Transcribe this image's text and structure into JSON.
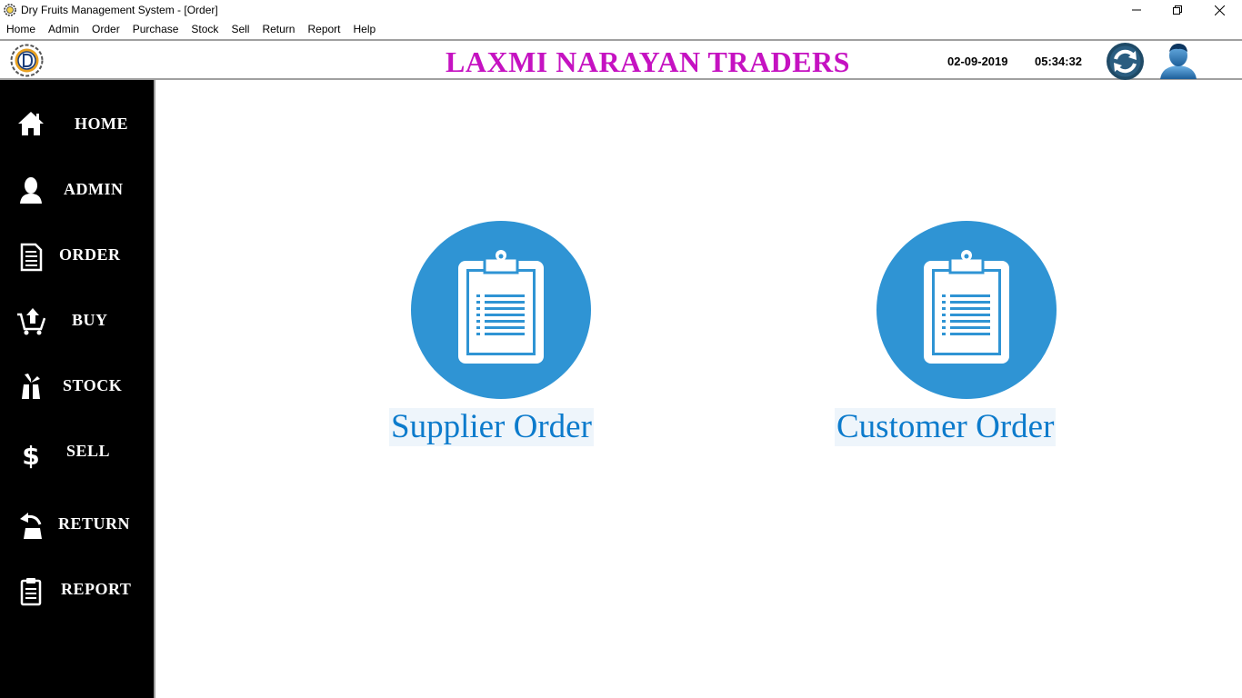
{
  "window": {
    "title": "Dry Fruits Management System - [Order]"
  },
  "menu": [
    "Home",
    "Admin",
    "Order",
    "Purchase",
    "Stock",
    "Sell",
    "Return",
    "Report",
    "Help"
  ],
  "header": {
    "company_name": "LAXMI NARAYAN TRADERS",
    "date": "02-09-2019",
    "time": "05:34:32"
  },
  "sidebar": {
    "items": [
      {
        "label": "HOME",
        "icon": "home-icon"
      },
      {
        "label": "ADMIN",
        "icon": "user-icon"
      },
      {
        "label": "ORDER",
        "icon": "document-icon"
      },
      {
        "label": "BUY",
        "icon": "cart-icon"
      },
      {
        "label": "STOCK",
        "icon": "box-icon"
      },
      {
        "label": "SELL",
        "icon": "dollar-icon"
      },
      {
        "label": "RETURN",
        "icon": "return-icon"
      },
      {
        "label": "REPORT",
        "icon": "clipboard-icon"
      }
    ]
  },
  "main": {
    "cards": [
      {
        "label": "Supplier Order",
        "icon": "clipboard-icon"
      },
      {
        "label": "Customer Order",
        "icon": "clipboard-icon"
      }
    ]
  },
  "colors": {
    "company_title": "#c512c1",
    "sidebar_bg": "#000000",
    "card_circle": "#2f94d4",
    "card_label": "#0c7bcc"
  }
}
